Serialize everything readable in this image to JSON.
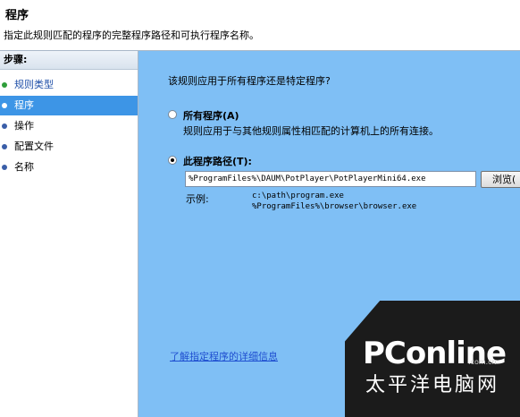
{
  "header": {
    "title": "程序",
    "subtitle": "指定此规则匹配的程序的完整程序路径和可执行程序名称。"
  },
  "sidebar": {
    "heading": "步骤:",
    "items": [
      {
        "label": "规则类型",
        "state": "done"
      },
      {
        "label": "程序",
        "state": "active"
      },
      {
        "label": "操作",
        "state": "pending"
      },
      {
        "label": "配置文件",
        "state": "pending"
      },
      {
        "label": "名称",
        "state": "pending"
      }
    ]
  },
  "main": {
    "question": "该规则应用于所有程序还是特定程序?",
    "option_all": {
      "label": "所有程序(A)",
      "description": "规则应用于与其他规则属性相匹配的计算机上的所有连接。",
      "selected": false
    },
    "option_path": {
      "label": "此程序路径(T):",
      "selected": true
    },
    "path_value": "%ProgramFiles%\\DAUM\\PotPlayer\\PotPlayerMini64.exe",
    "browse_label": "浏览(",
    "example_label": "示例:",
    "example_lines": [
      "c:\\path\\program.exe",
      "%ProgramFiles%\\browser\\browser.exe"
    ],
    "learn_link": "了解指定程序的详细信息"
  },
  "watermark": {
    "logo": "PConline",
    "site": ".com.cn",
    "chinese": "太平洋电脑网"
  },
  "colors": {
    "main_bg": "#7fbff5",
    "active_item": "#3d95e6",
    "link": "#1f4fd0"
  }
}
